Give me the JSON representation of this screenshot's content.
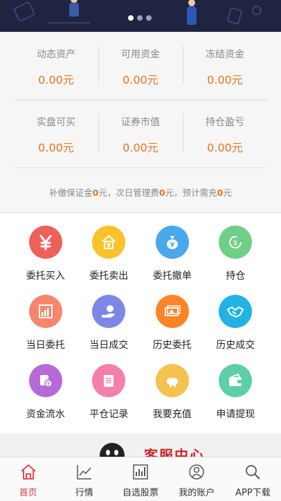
{
  "banner": {
    "slides": 3,
    "active_slide": 0
  },
  "assets": {
    "row1": [
      {
        "label": "动态资产",
        "value": "0.00元"
      },
      {
        "label": "可用资金",
        "value": "0.00元"
      },
      {
        "label": "冻结资金",
        "value": "0.00元"
      }
    ],
    "row2": [
      {
        "label": "实盘可买",
        "value": "0.00元"
      },
      {
        "label": "证券市值",
        "value": "0.00元"
      },
      {
        "label": "持仓盈亏",
        "value": "0.00元"
      }
    ],
    "note": {
      "part1": "补缴保证金",
      "num1": "0",
      "part2": "元，次日管理费",
      "num2": "0",
      "part3": "元，预计需充",
      "num3": "0",
      "part4": "元"
    }
  },
  "functions": [
    {
      "label": "委托买入",
      "icon": "yen-icon",
      "color": "#f0605a"
    },
    {
      "label": "委托卖出",
      "icon": "house-yen-icon",
      "color": "#fbc22c"
    },
    {
      "label": "委托撤单",
      "icon": "money-bag-icon",
      "color": "#4aa8ec"
    },
    {
      "label": "持仓",
      "icon": "coin-cycle-icon",
      "color": "#6fcf86"
    },
    {
      "label": "当日委托",
      "icon": "bar-chart-icon",
      "color": "#f7876c"
    },
    {
      "label": "当日成交",
      "icon": "hand-money-icon",
      "color": "#7d88e6"
    },
    {
      "label": "历史委托",
      "icon": "banknotes-icon",
      "color": "#fa8426"
    },
    {
      "label": "历史成交",
      "icon": "handshake-icon",
      "color": "#22b2e3"
    },
    {
      "label": "资金流水",
      "icon": "cash-flow-icon",
      "color": "#b66ad8"
    },
    {
      "label": "平仓记录",
      "icon": "record-icon",
      "color": "#f47fa9"
    },
    {
      "label": "我要充值",
      "icon": "piggy-bank-icon",
      "color": "#f3c24f"
    },
    {
      "label": "申请提现",
      "icon": "wallet-icon",
      "color": "#5ccfa8"
    }
  ],
  "service": {
    "title": "客服中心"
  },
  "tabbar": [
    {
      "label": "首页",
      "icon": "home-icon",
      "active": true
    },
    {
      "label": "行情",
      "icon": "trend-icon",
      "active": false
    },
    {
      "label": "自选股票",
      "icon": "stock-chart-icon",
      "active": false
    },
    {
      "label": "我的账户",
      "icon": "user-icon",
      "active": false
    },
    {
      "label": "APP下载",
      "icon": "search-icon",
      "active": false
    }
  ],
  "colors": {
    "accent": "#e8741c",
    "tab_active": "#e4393c",
    "service_red": "#d0202a"
  }
}
